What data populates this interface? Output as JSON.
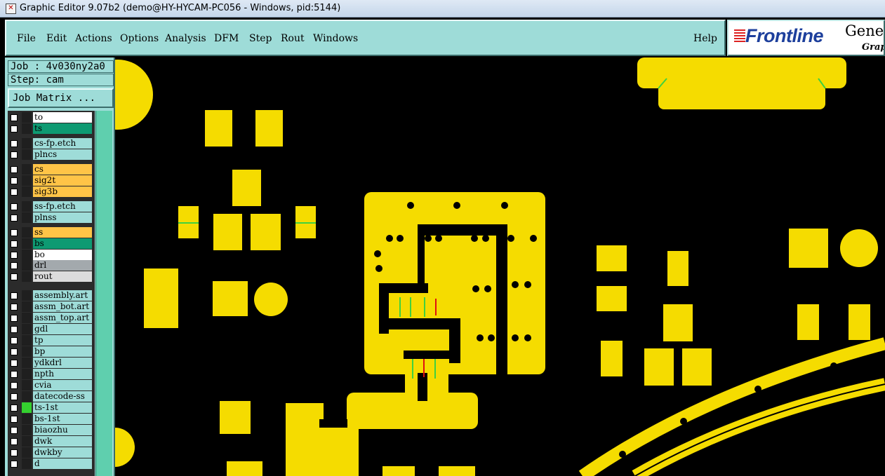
{
  "window": {
    "title": "Graphic Editor 9.07b2 (demo@HY-HYCAM-PC056 - Windows, pid:5144)"
  },
  "menu": {
    "items": [
      "File",
      "Edit",
      "Actions",
      "Options",
      "Analysis",
      "DFM",
      "Step",
      "Rout",
      "Windows"
    ],
    "help": "Help"
  },
  "branding": {
    "logo_text": "Frontline",
    "product": "Genesis",
    "subtitle": "Graphic"
  },
  "job": {
    "job_line": "Job : 4v030ny2a0",
    "step_line": "Step: cam",
    "matrix_button": "Job Matrix ..."
  },
  "layers": [
    {
      "name": "to",
      "color": "#ffffff"
    },
    {
      "name": "ts",
      "color": "#0e9a72"
    },
    {
      "name": "cs-fp.etch",
      "color": "#9edcd8"
    },
    {
      "name": "plncs",
      "color": "#9edcd8"
    },
    {
      "name": "cs",
      "color": "#ffc447"
    },
    {
      "name": "sig2t",
      "color": "#ffc447"
    },
    {
      "name": "sig3b",
      "color": "#ffc447"
    },
    {
      "name": "ss-fp.etch",
      "color": "#9edcd8"
    },
    {
      "name": "plnss",
      "color": "#9edcd8"
    },
    {
      "name": "ss",
      "color": "#ffc447"
    },
    {
      "name": "bs",
      "color": "#0e9a72"
    },
    {
      "name": "bo",
      "color": "#ffffff"
    },
    {
      "name": "drl",
      "color": "#a3a9ad"
    },
    {
      "name": "rout",
      "color": "#dcdcdc"
    },
    {
      "name": "assembly.art",
      "color": "#9edcd8"
    },
    {
      "name": "assm_bot.art",
      "color": "#9edcd8"
    },
    {
      "name": "assm_top.art",
      "color": "#9edcd8"
    },
    {
      "name": "gdl",
      "color": "#9edcd8"
    },
    {
      "name": "tp",
      "color": "#9edcd8"
    },
    {
      "name": "bp",
      "color": "#9edcd8"
    },
    {
      "name": "ydkdrl",
      "color": "#9edcd8"
    },
    {
      "name": "npth",
      "color": "#9edcd8"
    },
    {
      "name": "cvia",
      "color": "#9edcd8"
    },
    {
      "name": "datecode-ss",
      "color": "#9edcd8"
    },
    {
      "name": "ts-1st",
      "color": "#9edcd8"
    },
    {
      "name": "bs-1st",
      "color": "#9edcd8"
    },
    {
      "name": "biaozhu",
      "color": "#9edcd8"
    },
    {
      "name": "dwk",
      "color": "#9edcd8"
    },
    {
      "name": "dwkby",
      "color": "#9edcd8"
    },
    {
      "name": "d",
      "color": "#9edcd8"
    }
  ],
  "colors": {
    "copper": "#f5dc00",
    "background": "#000000",
    "panel": "#9edcd8",
    "highlight_green": "#3fd13f",
    "highlight_red": "#e01010"
  }
}
